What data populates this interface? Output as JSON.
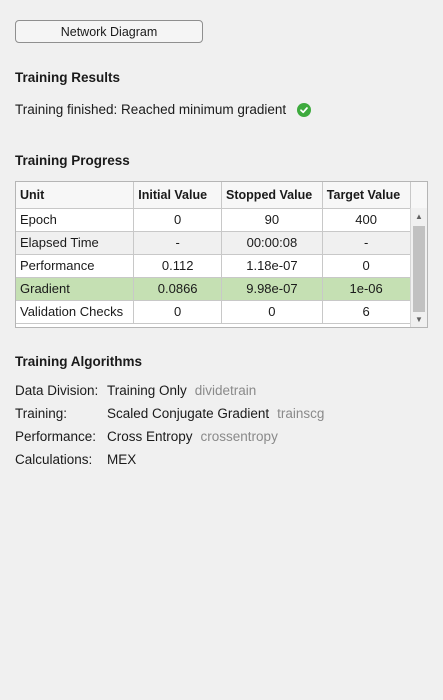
{
  "network_diagram_button": "Network Diagram",
  "results": {
    "heading": "Training Results",
    "status": "Training finished: Reached minimum gradient",
    "status_icon": "success-check-icon"
  },
  "progress": {
    "heading": "Training Progress",
    "columns": [
      "Unit",
      "Initial Value",
      "Stopped Value",
      "Target Value"
    ],
    "rows": [
      {
        "unit": "Epoch",
        "initial": "0",
        "stopped": "90",
        "target": "400"
      },
      {
        "unit": "Elapsed Time",
        "initial": "-",
        "stopped": "00:00:08",
        "target": "-"
      },
      {
        "unit": "Performance",
        "initial": "0.112",
        "stopped": "1.18e-07",
        "target": "0"
      },
      {
        "unit": "Gradient",
        "initial": "0.0866",
        "stopped": "9.98e-07",
        "target": "1e-06"
      },
      {
        "unit": "Validation Checks",
        "initial": "0",
        "stopped": "0",
        "target": "6"
      }
    ],
    "highlight_color": "#c5e0b3"
  },
  "algorithms": {
    "heading": "Training Algorithms",
    "items": [
      {
        "label": "Data Division:",
        "value": "Training Only",
        "fn": "dividetrain"
      },
      {
        "label": "Training:",
        "value": "Scaled Conjugate Gradient",
        "fn": "trainscg"
      },
      {
        "label": "Performance:",
        "value": "Cross Entropy",
        "fn": "crossentropy"
      },
      {
        "label": "Calculations:",
        "value": "MEX",
        "fn": ""
      }
    ]
  }
}
